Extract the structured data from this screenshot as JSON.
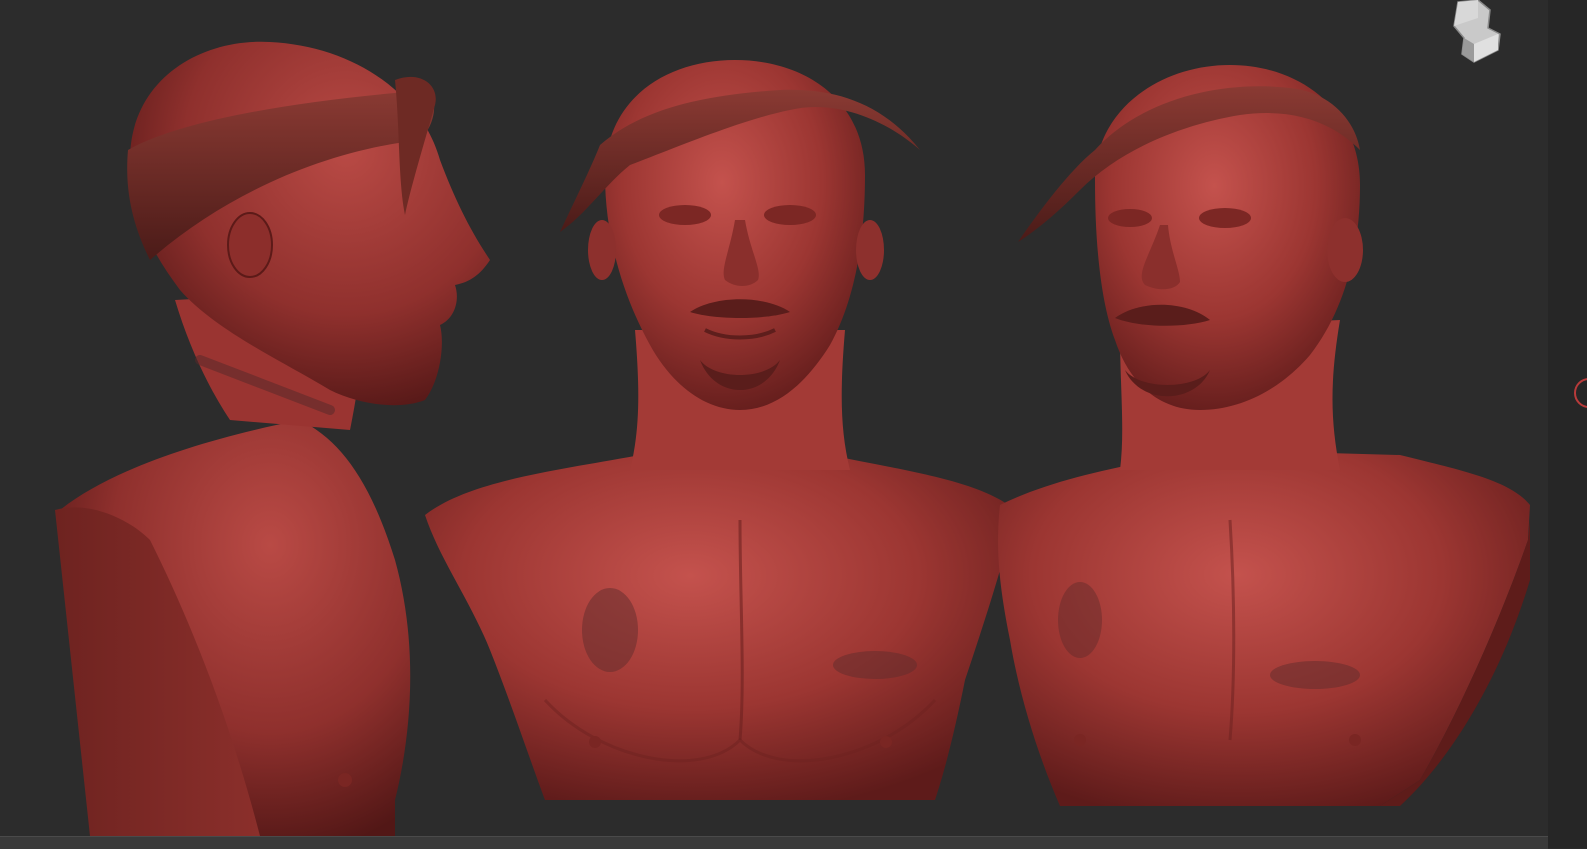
{
  "app": {
    "background_color": "#2c2c2c",
    "material_color": "#9a2f2f",
    "accent_ring_color": "#b83a3a"
  },
  "scene": {
    "views": [
      {
        "name": "side-profile-view"
      },
      {
        "name": "front-view"
      },
      {
        "name": "three-quarter-view"
      }
    ]
  },
  "nav_cube": {
    "icon": "navigation-cube-icon"
  },
  "rotate_handle": {
    "icon": "rotate-handle-icon"
  }
}
